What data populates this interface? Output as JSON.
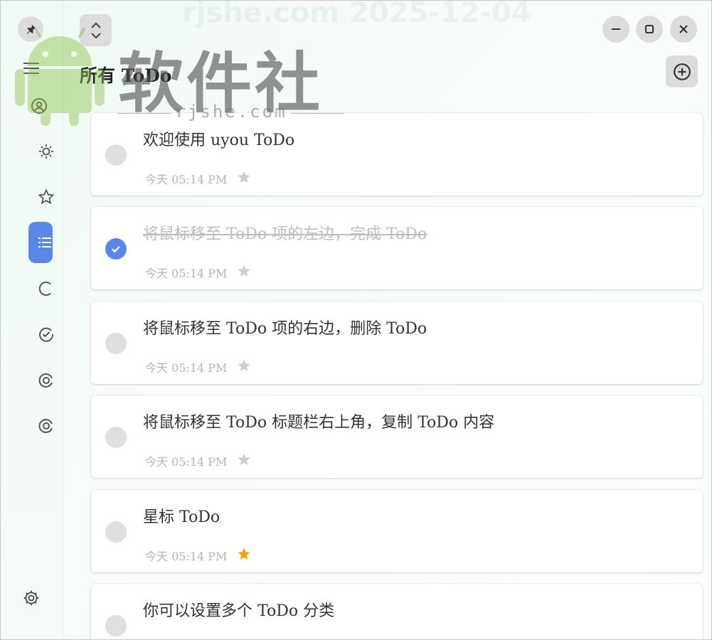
{
  "window": {
    "controls": [
      "minimize-icon",
      "maximize-icon",
      "close-icon"
    ]
  },
  "header": {
    "title": "所有 ToDo",
    "add_icon": "plus-circle-icon",
    "collapse_icon": "chevron-up-down-icon",
    "pin_icon": "pin-icon"
  },
  "sidebar": {
    "menu_icon": "hamburger-icon",
    "items": [
      {
        "icon": "user-circle-icon",
        "active": false
      },
      {
        "icon": "sun-icon",
        "active": false
      },
      {
        "icon": "star-outline-icon",
        "active": false
      },
      {
        "icon": "list-icon",
        "active": true
      },
      {
        "icon": "circle-loading-icon",
        "active": false
      },
      {
        "icon": "check-circle-icon",
        "active": false
      },
      {
        "icon": "at-icon",
        "active": false
      },
      {
        "icon": "at-icon",
        "active": false
      }
    ],
    "settings_icon": "gear-icon",
    "accent_color": "#5b86e5"
  },
  "todos": [
    {
      "title": "欢迎使用 uyou ToDo",
      "time": "今天 05:14 PM",
      "done": false,
      "starred": false
    },
    {
      "title": "将鼠标移至 ToDo 项的左边，完成 ToDo",
      "time": "今天 05:14 PM",
      "done": true,
      "starred": false
    },
    {
      "title": "将鼠标移至 ToDo 项的右边，删除 ToDo",
      "time": "今天 05:14 PM",
      "done": false,
      "starred": false
    },
    {
      "title": "将鼠标移至 ToDo 标题栏右上角，复制 ToDo 内容",
      "time": "今天 05:14 PM",
      "done": false,
      "starred": false
    },
    {
      "title": "星标 ToDo",
      "time": "今天 05:14 PM",
      "done": false,
      "starred": true
    },
    {
      "title": "你可以设置多个 ToDo 分类",
      "time": "",
      "done": false,
      "starred": false
    }
  ],
  "colors": {
    "star_on": "#e8a317",
    "star_off": "#cfcfcf",
    "check_done": "#5b86e5"
  },
  "watermark": {
    "date": "rjshe.com 2025-12-04",
    "brand": "软件社",
    "site": "rjshe.com"
  }
}
